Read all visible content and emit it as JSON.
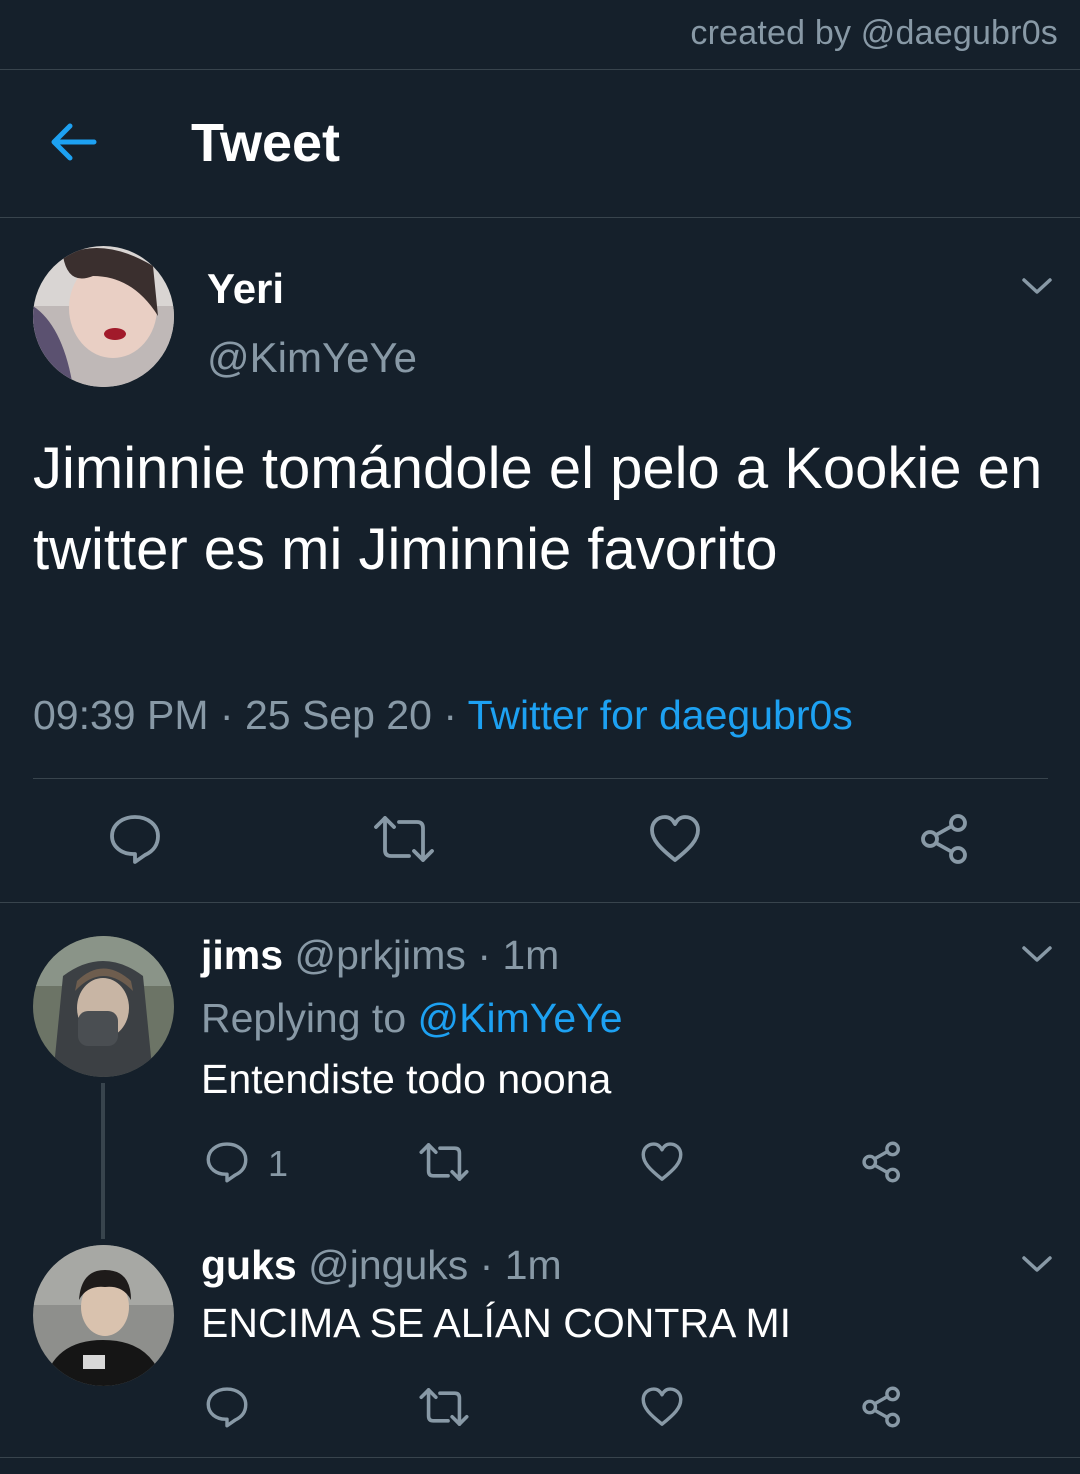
{
  "watermark": "created by @daegubr0s",
  "header": {
    "title": "Tweet",
    "back_icon": "arrow-left-icon"
  },
  "colors": {
    "background": "#15202b",
    "accent": "#1da1f2",
    "muted": "#8899a6",
    "divider": "#38444d"
  },
  "tweet": {
    "name": "Yeri",
    "handle": "@KimYeYe",
    "text": "Jiminnie tomándole el pelo a Kookie en twitter es mi Jiminnie favorito",
    "time": "09:39 PM",
    "sep": "·",
    "date": "25 Sep 20",
    "source": "Twitter for daegubr0s",
    "actions": [
      "reply-icon",
      "retweet-icon",
      "like-icon",
      "share-icon"
    ]
  },
  "replies": [
    {
      "name": "jims",
      "handle": "@prkjims",
      "time": "· 1m",
      "replying_label": "Replying to",
      "replying_to": "@KimYeYe",
      "text": "Entendiste todo noona",
      "reply_count": "1"
    },
    {
      "name": "guks",
      "handle": "@jnguks",
      "time": "· 1m",
      "text": "ENCIMA SE ALÍAN CONTRA MI"
    }
  ]
}
